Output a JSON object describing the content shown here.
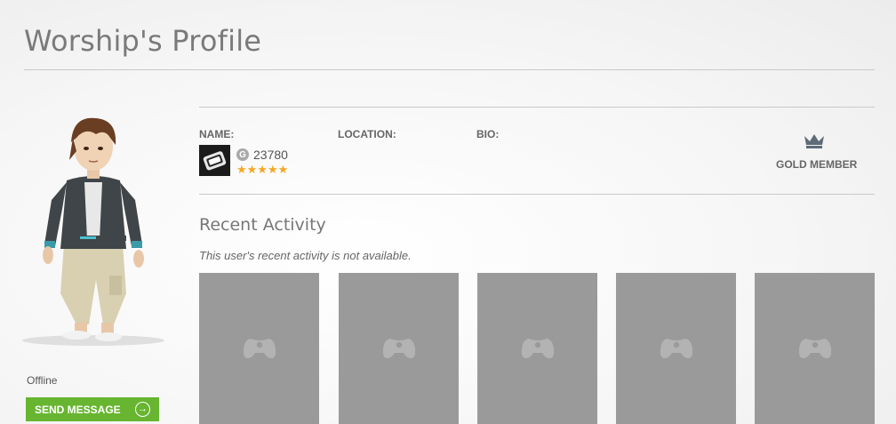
{
  "header": {
    "title": "Worship's Profile"
  },
  "profile": {
    "status": "Offline",
    "send_message_label": "SEND MESSAGE",
    "labels": {
      "name": "NAME:",
      "location": "LOCATION:",
      "bio": "BIO:"
    },
    "gamerscore_badge": "G",
    "gamerscore": "23780",
    "reputation_stars": 5,
    "stars_text": "★★★★★",
    "membership": "GOLD MEMBER"
  },
  "activity": {
    "title": "Recent Activity",
    "note": "This user's recent activity is not available.",
    "tiles": [
      {
        "icon": "controller-icon"
      },
      {
        "icon": "controller-icon"
      },
      {
        "icon": "controller-icon"
      },
      {
        "icon": "controller-icon"
      },
      {
        "icon": "controller-icon"
      }
    ]
  },
  "colors": {
    "accent_green": "#67b530",
    "star_orange": "#f5a623",
    "tile_gray": "#9a9a9a",
    "title_gray": "#7a7a7a"
  }
}
